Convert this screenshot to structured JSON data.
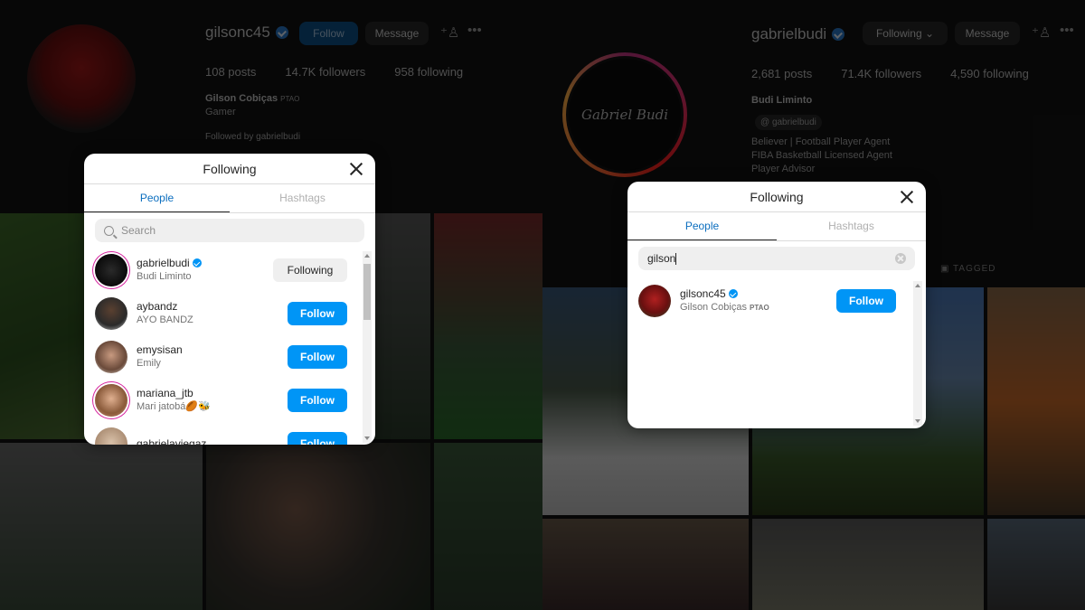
{
  "left_profile": {
    "username": "gilsonc45",
    "follow_label": "Follow",
    "message_label": "Message",
    "posts": "108 posts",
    "followers": "14.7K followers",
    "following": "958 following",
    "full_name": "Gilson Cobiças",
    "tag": "PTAO",
    "category": "Gamer",
    "followed_by": "Followed by gabrielbudi",
    "modal": {
      "title": "Following",
      "tabs": [
        "People",
        "Hashtags"
      ],
      "search_placeholder": "Search",
      "rows": [
        {
          "username": "gabrielbudi",
          "name": "Budi Liminto",
          "verified": true,
          "button": "Following"
        },
        {
          "username": "aybandz",
          "name": "AYO BANDZ",
          "verified": false,
          "button": "Follow"
        },
        {
          "username": "emysisan",
          "name": "Emily",
          "verified": false,
          "button": "Follow"
        },
        {
          "username": "mariana_jtb",
          "name": "Mari jatobá🏉🐝",
          "verified": false,
          "button": "Follow"
        },
        {
          "username": "gabrielaviegaz",
          "name": "",
          "verified": false,
          "button": "Follow"
        }
      ]
    }
  },
  "right_profile": {
    "username": "gabrielbudi",
    "following_label": "Following ⌄",
    "message_label": "Message",
    "posts": "2,681 posts",
    "followers": "71.4K followers",
    "following": "4,590 following",
    "full_name": "Budi Liminto",
    "threads_handle": "gabrielbudi",
    "bio_lines": [
      "Believer | Football Player Agent",
      "FIBA Basketball Licensed Agent",
      "Player Advisor"
    ],
    "tagged_label": "TAGGED",
    "modal": {
      "title": "Following",
      "tabs": [
        "People",
        "Hashtags"
      ],
      "search_value": "gilson",
      "result": {
        "username": "gilsonc45",
        "name": "Gilson Cobiças",
        "tag": "PTAO",
        "verified": true,
        "button": "Follow"
      }
    }
  },
  "colors": {
    "accent_blue": "#0095f6",
    "verified_blue": "#0095f6",
    "story_ring": "#d6249f"
  }
}
